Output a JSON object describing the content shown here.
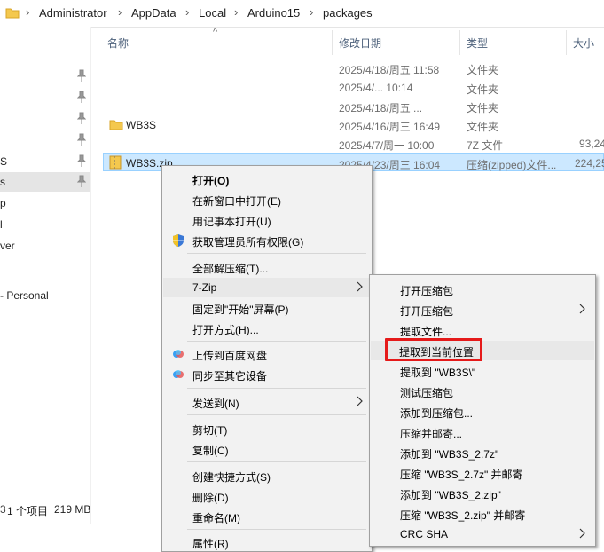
{
  "breadcrumb": [
    "Administrator",
    "AppData",
    "Local",
    "Arduino15",
    "packages"
  ],
  "columns": {
    "name": "名称",
    "modified": "修改日期",
    "type": "类型",
    "size": "大小"
  },
  "nav_items": [
    "S",
    "s",
    "p",
    "l",
    "ver",
    "- Personal"
  ],
  "files": [
    {
      "name": "",
      "date": "2025/4/18/周五 11:58",
      "type": "文件夹",
      "size": ""
    },
    {
      "name": "",
      "date": "2025/4/... 10:14",
      "type": "文件夹",
      "size": ""
    },
    {
      "name": "",
      "date": "2025/4/18/周五 ...",
      "type": "文件夹",
      "size": ""
    },
    {
      "name": "WB3S",
      "date": "2025/4/16/周三 16:49",
      "type": "文件夹",
      "size": ""
    },
    {
      "name": "",
      "date": "2025/4/7/周一 10:00",
      "type": "7Z 文件",
      "size": "93,24"
    },
    {
      "name": "WB3S.zip",
      "date": "2025/4/23/周三 16:04",
      "type": "压缩(zipped)文件...",
      "size": "224,25"
    }
  ],
  "status": {
    "count": "1 个项目",
    "size": "219 MB"
  },
  "context_menu": {
    "open": "打开(O)",
    "open_new_window": "在新窗口中打开(E)",
    "open_notepad": "用记事本打开(U)",
    "take_ownership": "获取管理员所有权限(G)",
    "extract_all": "全部解压缩(T)...",
    "seven_zip": "7-Zip",
    "pin_start": "固定到\"开始\"屏幕(P)",
    "open_with": "打开方式(H)...",
    "upload_baidu": "上传到百度网盘",
    "sync_devices": "同步至其它设备",
    "send_to": "发送到(N)",
    "cut": "剪切(T)",
    "copy": "复制(C)",
    "create_shortcut": "创建快捷方式(S)",
    "delete": "删除(D)",
    "rename": "重命名(M)",
    "properties": "属性(R)"
  },
  "submenu_7zip": [
    "打开压缩包",
    "打开压缩包",
    "提取文件...",
    "提取到当前位置",
    "提取到 \"WB3S\\\"",
    "测试压缩包",
    "添加到压缩包...",
    "压缩并邮寄...",
    "添加到 \"WB3S_2.7z\"",
    "压缩 \"WB3S_2.7z\" 并邮寄",
    "添加到 \"WB3S_2.zip\"",
    "压缩 \"WB3S_2.zip\" 并邮寄",
    "CRC SHA"
  ],
  "colors": {
    "selection": "#cce8ff",
    "highlight_box": "#e51a1a",
    "folder": "#f4c84e"
  }
}
